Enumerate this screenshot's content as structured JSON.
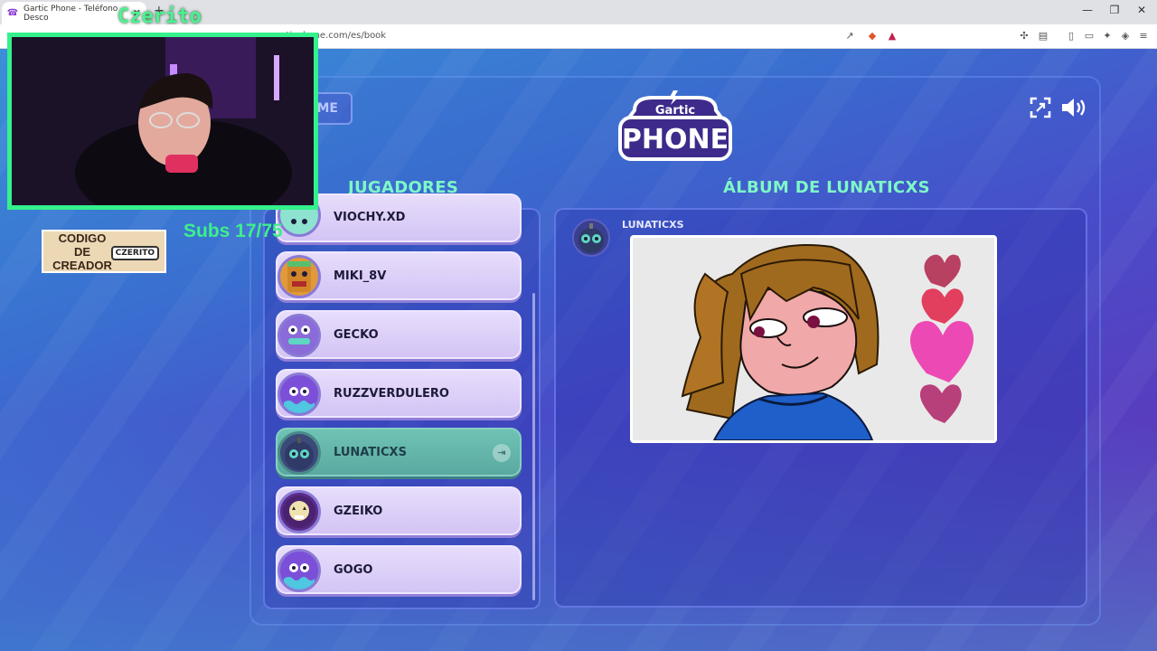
{
  "browser": {
    "tab_title": "Gartic Phone - Teléfono Desco",
    "url": "garticphone.com/es/book"
  },
  "header": {
    "home_label": "OME",
    "logo_top": "Gartic",
    "logo_bottom": "PHONE"
  },
  "sections": {
    "players_title": "JUGADORES",
    "album_title": "ÁLBUM DE LUNATICXS"
  },
  "players": [
    {
      "name": "VIOCHY.XD"
    },
    {
      "name": "MIKI_8V"
    },
    {
      "name": "GECKO"
    },
    {
      "name": "RUZZVERDULERO"
    },
    {
      "name": "LUNATICXS"
    },
    {
      "name": "GZEIKO"
    },
    {
      "name": "GOGO"
    }
  ],
  "album": {
    "author": "LUNATICXS"
  },
  "overlay": {
    "streamer_name": "Czerito",
    "creator_code_label": "CODIGO DE CREADOR",
    "creator_logo": "CZERITO",
    "subs_text": "Subs 17/75"
  },
  "colors": {
    "accent_green": "#7ef7c7",
    "active_player": "#5aa9a1",
    "player_card": "#d3c4f5",
    "webcam_border": "#34f18c"
  }
}
